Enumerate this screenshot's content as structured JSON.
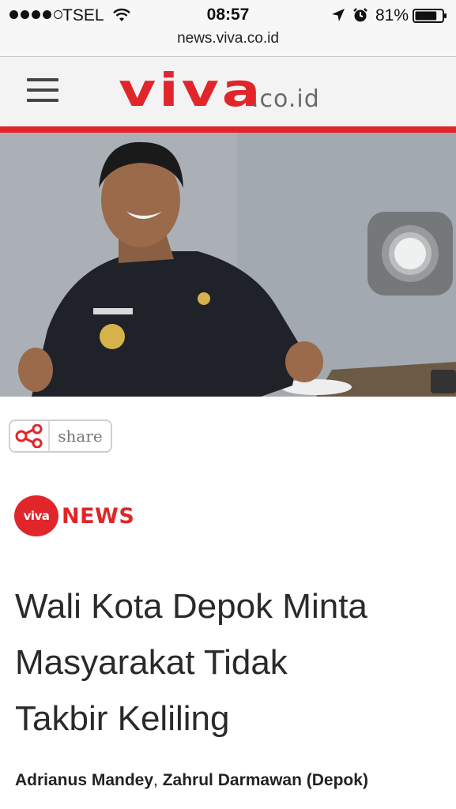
{
  "status_bar": {
    "carrier": "TSEL",
    "time": "08:57",
    "battery": "81%",
    "battery_level": 0.81,
    "icons": [
      "signal-dots-icon",
      "wifi-icon",
      "location-arrow-icon",
      "alarm-clock-icon",
      "battery-icon"
    ]
  },
  "browser": {
    "url": "news.viva.co.id"
  },
  "header": {
    "menu_icon": "hamburger-menu-icon",
    "logo_main": "VIVA",
    "logo_suffix": ".co.id",
    "accent_color": "#e0262b"
  },
  "share": {
    "label": "share",
    "icon": "share-network-icon"
  },
  "section": {
    "badge": "viva",
    "name": "NEWS"
  },
  "article": {
    "headline_lines": [
      "Wali Kota Depok Minta",
      "Masyarakat Tidak",
      "Takbir Keliling"
    ],
    "author_1": "Adrianus Mandey",
    "separator": ", ",
    "author_2": "Zahrul Darmawan (Depok)"
  }
}
